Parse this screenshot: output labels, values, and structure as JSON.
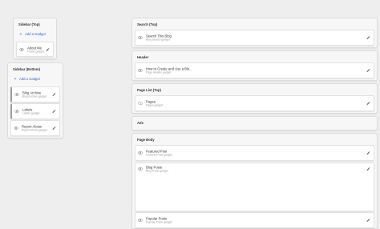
{
  "left": {
    "sidebar_top": {
      "title": "Sidebar (Top)",
      "add_label": "Add a Gadget",
      "gadgets": [
        {
          "name": "About Me",
          "type": "Profile gadget"
        }
      ]
    },
    "sidebar_bottom": {
      "title": "Sidebar (Bottom)",
      "add_label": "Add a Gadget",
      "gadgets": [
        {
          "name": "Blog Archive",
          "type": "Blog Archive gadget"
        },
        {
          "name": "Labels",
          "type": "Labels gadget"
        },
        {
          "name": "Report Abuse",
          "type": "Report Abuse gadget"
        }
      ]
    }
  },
  "main": {
    "search_top": {
      "title": "Search (Top)",
      "gadgets": [
        {
          "name": "Search This Blog",
          "type": "Blog Search gadget"
        }
      ]
    },
    "header": {
      "title": "Header",
      "gadgets": [
        {
          "name": "How to Create and Use a Blo...",
          "type": "Page Header gadget"
        }
      ]
    },
    "page_list_top": {
      "title": "Page List (Top)",
      "gadgets": [
        {
          "name": "Pages",
          "type": "Pages gadget"
        }
      ]
    },
    "ads": {
      "title": "Ads"
    },
    "page_body": {
      "title": "Page Body",
      "gadgets": [
        {
          "name": "Featured Post",
          "type": "Featured Post gadget"
        },
        {
          "name": "Blog Posts",
          "type": "Blog Posts gadget"
        },
        {
          "name": "Popular Posts",
          "type": "Popular Posts gadget"
        }
      ]
    }
  },
  "icons": {
    "visibility": "eye-icon",
    "hidden": "eye-off-icon",
    "edit": "pencil-icon",
    "add": "plus-icon"
  },
  "colors": {
    "accent": "#3367d6",
    "background": "#eeeeee",
    "section": "#f7f7f7",
    "gadget": "#ffffff"
  }
}
